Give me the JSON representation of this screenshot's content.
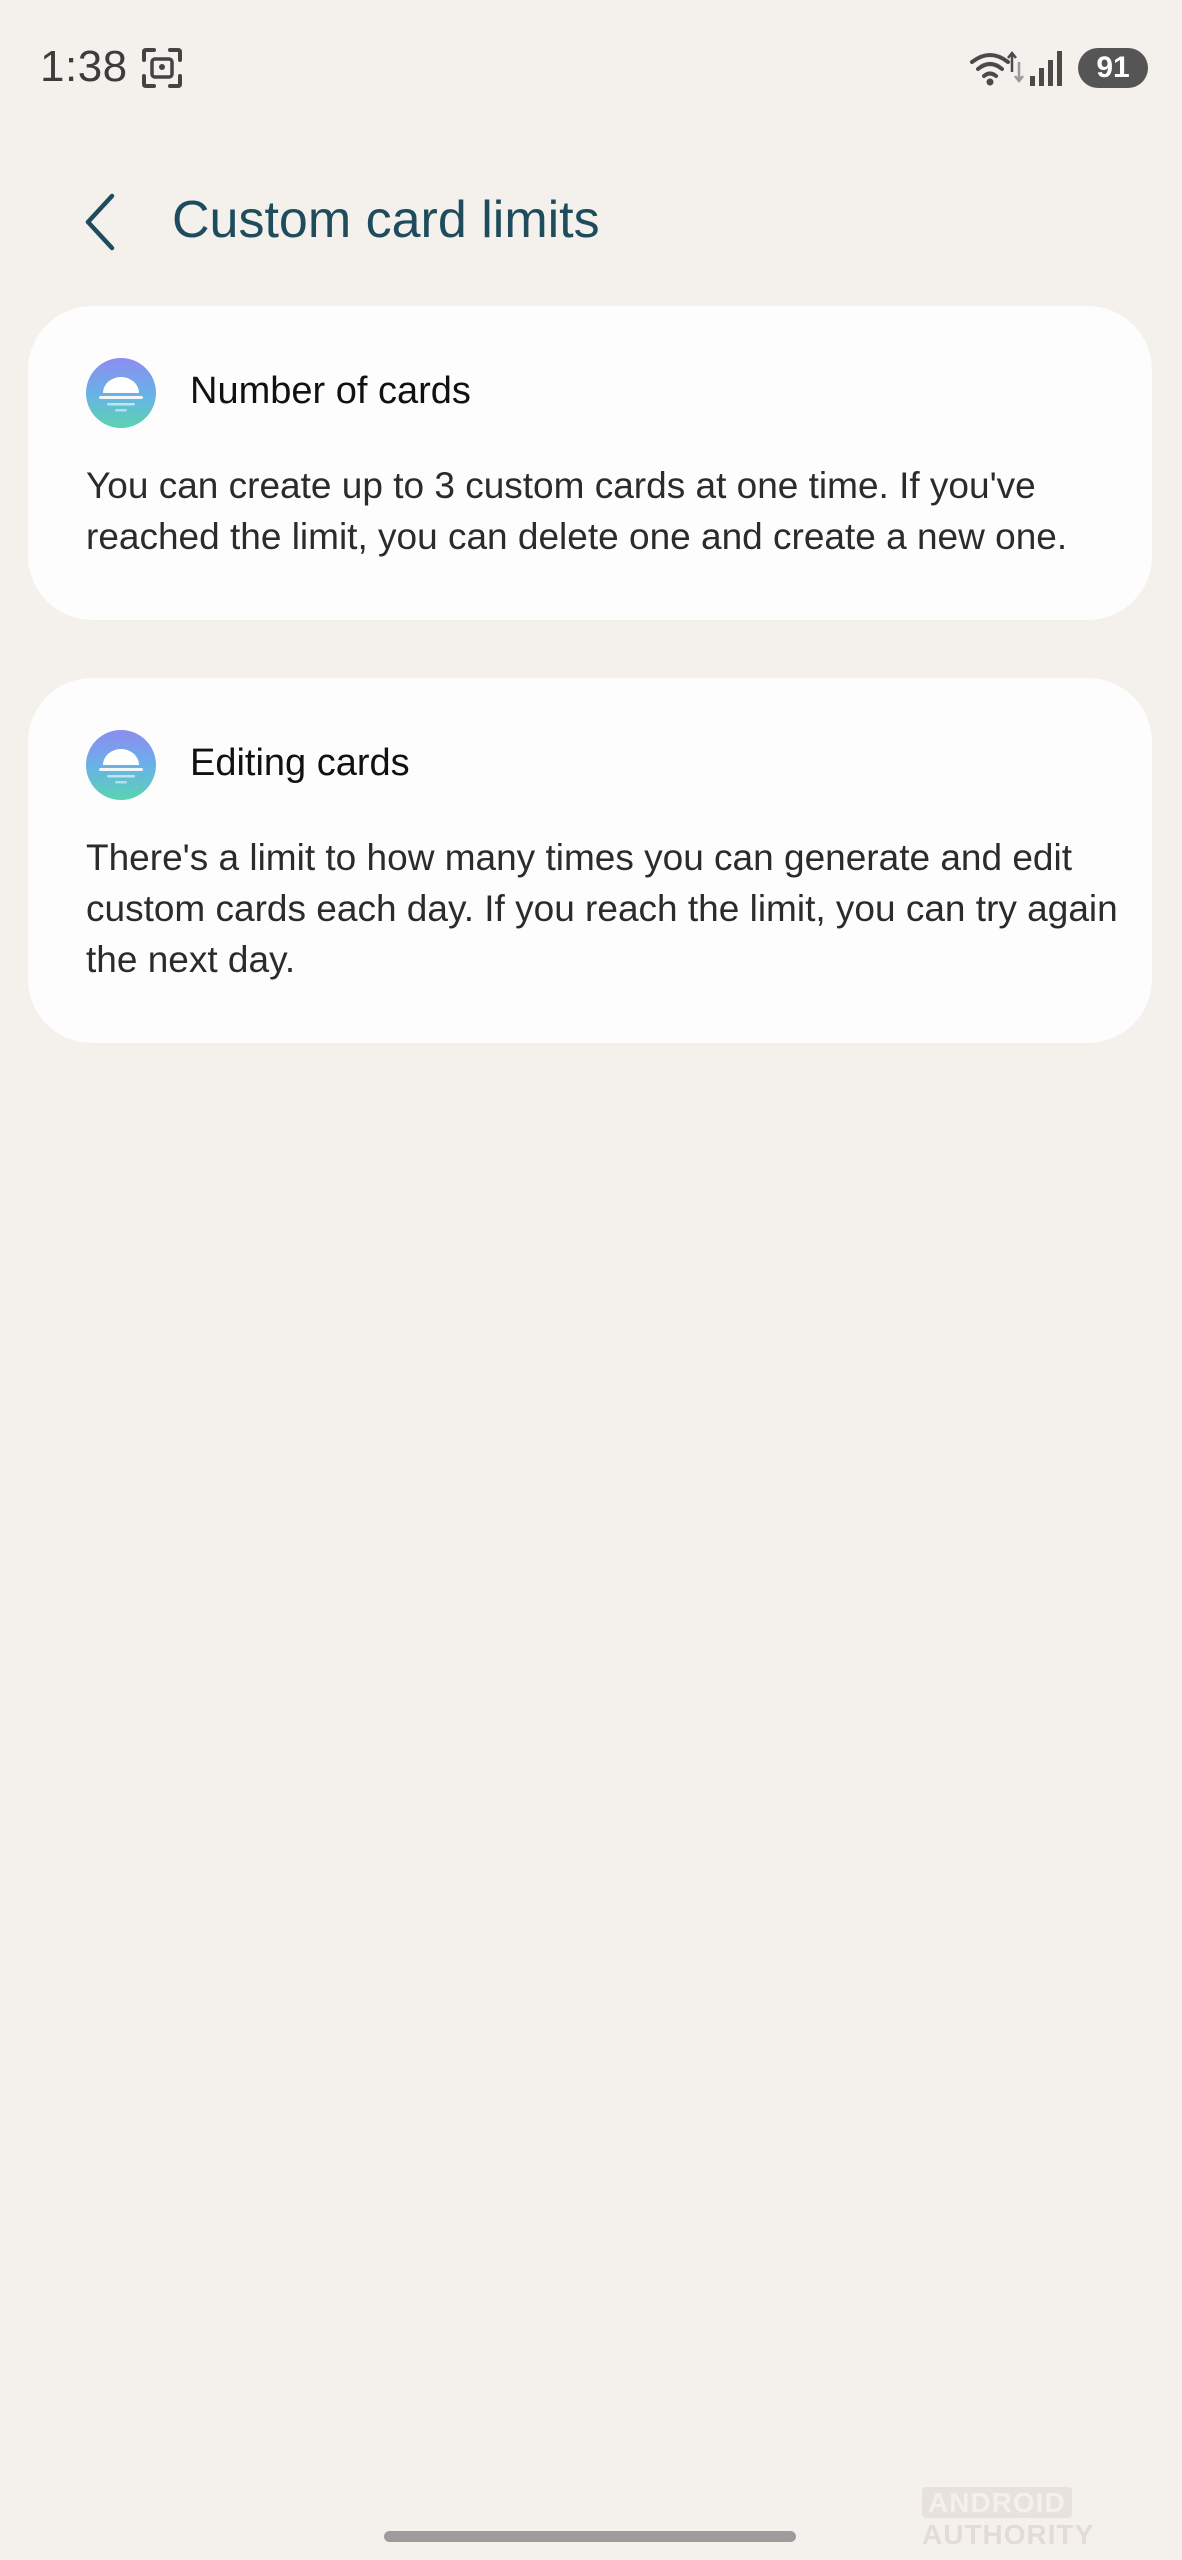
{
  "status_bar": {
    "time": "1:38",
    "battery": "91",
    "icons": [
      "screenshot-icon",
      "wifi-icon",
      "signal-icon",
      "battery-icon"
    ]
  },
  "header": {
    "title": "Custom card limits",
    "back_icon": "chevron-left-icon"
  },
  "cards": [
    {
      "heading": "Number of cards",
      "body": "You can create up to 3 custom cards at one time. If you've reached the limit, you can delete one and create a new one.",
      "icon": "sunset-gradient-icon"
    },
    {
      "heading": "Editing cards",
      "body": "There's a limit to how many times you can generate and edit custom cards each day. If you reach the limit, you can try again the next day.",
      "icon": "sunset-gradient-icon"
    }
  ],
  "watermark": {
    "part1": "ANDROID",
    "part2": "AUTHORITY"
  },
  "colors": {
    "background": "#f4f0ec",
    "card": "#fdfdfd",
    "title": "#1e4c5c",
    "icon_gradient_top": "#8e8cf0",
    "icon_gradient_bottom": "#5ad4b0"
  }
}
